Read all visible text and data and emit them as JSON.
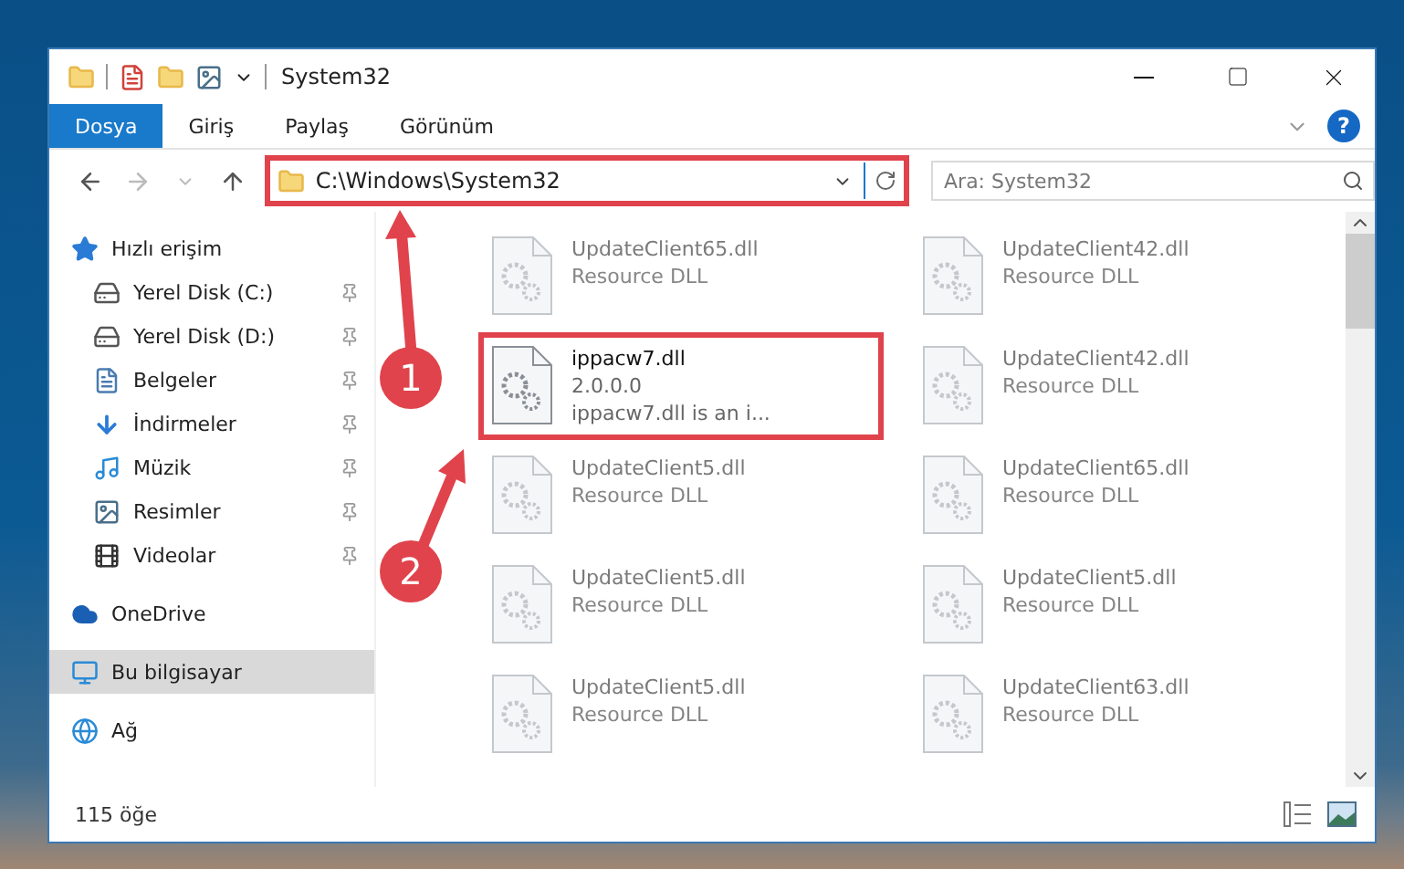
{
  "window": {
    "title": "System32"
  },
  "ribbon_tabs": [
    {
      "label": "Dosya",
      "selected": true
    },
    {
      "label": "Giriş",
      "selected": false
    },
    {
      "label": "Paylaş",
      "selected": false
    },
    {
      "label": "Görünüm",
      "selected": false
    }
  ],
  "help_button": {
    "label": "?"
  },
  "address_bar": {
    "path": "C:\\Windows\\System32",
    "highlighted": true
  },
  "search": {
    "placeholder": "Ara: System32"
  },
  "sidebar": {
    "items": [
      {
        "label": "Hızlı erişim",
        "kind": "star",
        "selected": false,
        "children": [
          {
            "label": "Yerel Disk (C:)",
            "kind": "drivec",
            "pinned": true
          },
          {
            "label": "Yerel Disk (D:)",
            "kind": "drive",
            "pinned": true
          },
          {
            "label": "Belgeler",
            "kind": "documents",
            "pinned": true
          },
          {
            "label": "İndirmeler",
            "kind": "downloads",
            "pinned": true
          },
          {
            "label": "Müzik",
            "kind": "music",
            "pinned": true
          },
          {
            "label": "Resimler",
            "kind": "pictures",
            "pinned": true
          },
          {
            "label": "Videolar",
            "kind": "videos",
            "pinned": true
          }
        ]
      },
      {
        "label": "OneDrive",
        "kind": "cloud",
        "selected": false
      },
      {
        "label": "Bu bilgisayar",
        "kind": "computer",
        "selected": true
      },
      {
        "label": "Ağ",
        "kind": "network",
        "selected": false
      }
    ]
  },
  "files": [
    {
      "name": "UpdateClient65.dll",
      "lines": [
        "Resource DLL"
      ],
      "blurred": true,
      "highlighted": false
    },
    {
      "name": "UpdateClient42.dll",
      "lines": [
        "Resource DLL"
      ],
      "blurred": true,
      "highlighted": false
    },
    {
      "name": "ippacw7.dll",
      "lines": [
        "2.0.0.0",
        "ippacw7.dll is an i..."
      ],
      "blurred": false,
      "highlighted": true
    },
    {
      "name": "UpdateClient42.dll",
      "lines": [
        "Resource DLL"
      ],
      "blurred": true,
      "highlighted": false
    },
    {
      "name": "UpdateClient5.dll",
      "lines": [
        "Resource DLL"
      ],
      "blurred": true,
      "highlighted": false
    },
    {
      "name": "UpdateClient65.dll",
      "lines": [
        "Resource DLL"
      ],
      "blurred": true,
      "highlighted": false
    },
    {
      "name": "UpdateClient5.dll",
      "lines": [
        "Resource DLL"
      ],
      "blurred": true,
      "highlighted": false
    },
    {
      "name": "UpdateClient5.dll",
      "lines": [
        "Resource DLL"
      ],
      "blurred": true,
      "highlighted": false
    },
    {
      "name": "UpdateClient5.dll",
      "lines": [
        "Resource DLL"
      ],
      "blurred": true,
      "highlighted": false
    },
    {
      "name": "UpdateClient63.dll",
      "lines": [
        "Resource DLL"
      ],
      "blurred": true,
      "highlighted": false
    }
  ],
  "status_bar": {
    "count": "115 öğe"
  },
  "annotations": [
    {
      "label": "1"
    },
    {
      "label": "2"
    }
  ]
}
